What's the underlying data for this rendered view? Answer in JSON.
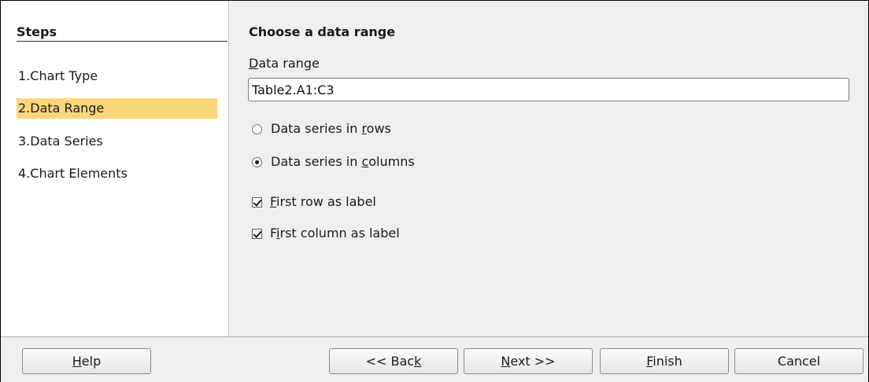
{
  "steps": {
    "title": "Steps",
    "items": [
      {
        "label": "1.Chart Type"
      },
      {
        "label": "2.Data Range"
      },
      {
        "label": "3.Data Series"
      },
      {
        "label": "4.Chart Elements"
      }
    ],
    "active_index": 1
  },
  "content": {
    "title": "Choose a data range",
    "data_range_label": {
      "pre": "",
      "mn": "D",
      "post": "ata range"
    },
    "data_range_value": "Table2.A1:C3",
    "radio_rows": {
      "pre": "Data series in ",
      "mn": "r",
      "post": "ows",
      "checked": false
    },
    "radio_columns": {
      "pre": "Data series in ",
      "mn": "c",
      "post": "olumns",
      "checked": true
    },
    "check_first_row": {
      "pre": "",
      "mn": "F",
      "post": "irst row as label",
      "checked": true
    },
    "check_first_column": {
      "pre": "F",
      "mn": "i",
      "post": "rst column as label",
      "checked": true
    }
  },
  "buttons": {
    "help": {
      "pre": "",
      "mn": "H",
      "post": "elp"
    },
    "back": {
      "pre": "<< Bac",
      "mn": "k",
      "post": ""
    },
    "next": {
      "pre": "",
      "mn": "N",
      "post": "ext >>"
    },
    "finish": {
      "pre": "",
      "mn": "F",
      "post": "inish"
    },
    "cancel": {
      "pre": "Cancel",
      "mn": "",
      "post": ""
    }
  },
  "colors": {
    "active_step": "#f9d67a",
    "panel_bg": "#efefef",
    "steps_bg": "#ffffff"
  }
}
